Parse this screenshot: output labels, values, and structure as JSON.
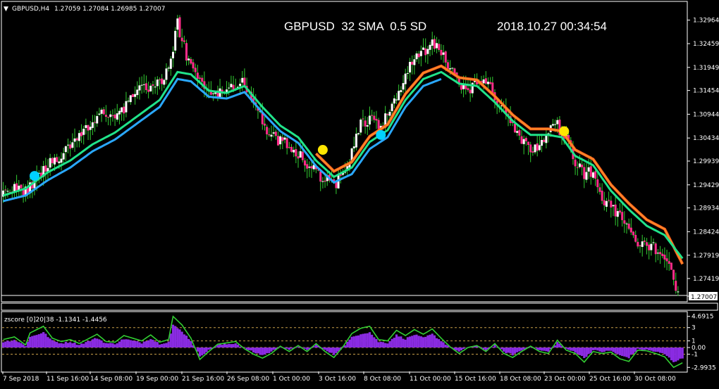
{
  "main_header": {
    "arrow": "▼",
    "symbol_tf": "GBPUSD,H4",
    "ohlc": "1.27059 1.27084 1.26985 1.27007"
  },
  "overlay": {
    "title": "GBPUSD  32 SMA  0.5 SD",
    "datetime": "2018.10.27 00:34:54"
  },
  "current_price_label": "1.27007",
  "price_axis": {
    "labels": [
      "1.32964",
      "1.32459",
      "1.31949",
      "1.31454",
      "1.30944",
      "1.30434",
      "1.29939",
      "1.29429",
      "1.28934",
      "1.28424",
      "1.27919",
      "1.27419"
    ],
    "values": [
      1.32964,
      1.32459,
      1.31949,
      1.31454,
      1.30944,
      1.30434,
      1.29939,
      1.29429,
      1.28934,
      1.28424,
      1.27919,
      1.27419
    ],
    "range": [
      1.2695,
      1.3335
    ]
  },
  "sub_header": "zscore [0]20|38 -1.1341 -1.4456",
  "z_axis": {
    "labels": [
      "4.6915",
      "3",
      "1",
      "0.00",
      "-1",
      "-2.9935"
    ],
    "values": [
      4.6915,
      3,
      1,
      0,
      -1,
      -2.9935
    ],
    "range": [
      -3.6,
      5.3
    ]
  },
  "time_axis": [
    "7 Sep 2018",
    "11 Sep 16:00",
    "14 Sep 08:00",
    "19 Sep 00:00",
    "21 Sep 16:00",
    "26 Sep 08:00",
    "1 Oct 00:00",
    "3 Oct 16:00",
    "8 Oct 08:00",
    "11 Oct 00:00",
    "15 Oct 16:00",
    "18 Oct 08:00",
    "23 Oct 00:00",
    "25 Oct 16:00",
    "30 Oct 08:00"
  ],
  "colors": {
    "up_candle": "#ffffff",
    "down_candle": "#ff2d8a",
    "wick": "#32cd32",
    "sma_center": "#20e38a",
    "band_lower": "#2aa8ff",
    "band_upper": "#ff8c2a",
    "signal_buy": "#00d2ff",
    "signal_sell": "#ffe600",
    "zscore_line": "#32cd32",
    "zscore_hist": "#8a2be2",
    "axis": "#ffffff",
    "level_line": "#c8a04a"
  },
  "chart_data": [
    {
      "type": "candlestick",
      "title": "GBPUSD  32 SMA  0.5 SD",
      "ylim": [
        1.2695,
        1.3335
      ],
      "close_path": [
        [
          0,
          1.292
        ],
        [
          5,
          1.2935
        ],
        [
          10,
          1.293
        ],
        [
          15,
          1.296
        ],
        [
          20,
          1.2985
        ],
        [
          25,
          1.3
        ],
        [
          30,
          1.303
        ],
        [
          35,
          1.3055
        ],
        [
          40,
          1.308
        ],
        [
          45,
          1.31
        ],
        [
          50,
          1.3095
        ],
        [
          55,
          1.311
        ],
        [
          60,
          1.3145
        ],
        [
          65,
          1.315
        ],
        [
          70,
          1.316
        ],
        [
          75,
          1.321
        ],
        [
          78,
          1.329
        ],
        [
          82,
          1.322
        ],
        [
          86,
          1.319
        ],
        [
          90,
          1.314
        ],
        [
          95,
          1.3135
        ],
        [
          100,
          1.3145
        ],
        [
          104,
          1.316
        ],
        [
          108,
          1.3165
        ],
        [
          112,
          1.312
        ],
        [
          116,
          1.308
        ],
        [
          120,
          1.3045
        ],
        [
          124,
          1.3035
        ],
        [
          128,
          1.303
        ],
        [
          132,
          1.301
        ],
        [
          136,
          1.2985
        ],
        [
          140,
          1.297
        ],
        [
          144,
          1.2955
        ],
        [
          148,
          1.2945
        ],
        [
          152,
          1.296
        ],
        [
          156,
          1.301
        ],
        [
          160,
          1.307
        ],
        [
          164,
          1.3085
        ],
        [
          168,
          1.3065
        ],
        [
          172,
          1.3095
        ],
        [
          176,
          1.313
        ],
        [
          180,
          1.3185
        ],
        [
          184,
          1.3215
        ],
        [
          188,
          1.323
        ],
        [
          192,
          1.3245
        ],
        [
          196,
          1.3225
        ],
        [
          200,
          1.3195
        ],
        [
          204,
          1.315
        ],
        [
          208,
          1.314
        ],
        [
          212,
          1.3165
        ],
        [
          216,
          1.3165
        ],
        [
          220,
          1.313
        ],
        [
          224,
          1.31
        ],
        [
          228,
          1.3065
        ],
        [
          232,
          1.3035
        ],
        [
          236,
          1.302
        ],
        [
          240,
          1.303
        ],
        [
          244,
          1.3065
        ],
        [
          248,
          1.307
        ],
        [
          252,
          1.304
        ],
        [
          256,
          1.2995
        ],
        [
          260,
          1.2965
        ],
        [
          264,
          1.2975
        ],
        [
          268,
          1.2915
        ],
        [
          272,
          1.289
        ],
        [
          276,
          1.288
        ],
        [
          280,
          1.2845
        ],
        [
          284,
          1.281
        ],
        [
          288,
          1.2815
        ],
        [
          292,
          1.2805
        ],
        [
          296,
          1.2795
        ],
        [
          300,
          1.274
        ],
        [
          302,
          1.2705
        ]
      ],
      "sma_center": [
        [
          0,
          1.292
        ],
        [
          10,
          1.2935
        ],
        [
          20,
          1.297
        ],
        [
          30,
          1.2995
        ],
        [
          40,
          1.303
        ],
        [
          50,
          1.3055
        ],
        [
          60,
          1.309
        ],
        [
          70,
          1.3125
        ],
        [
          78,
          1.3185
        ],
        [
          84,
          1.318
        ],
        [
          92,
          1.3145
        ],
        [
          100,
          1.314
        ],
        [
          108,
          1.3155
        ],
        [
          116,
          1.311
        ],
        [
          124,
          1.307
        ],
        [
          132,
          1.3045
        ],
        [
          140,
          1.2995
        ],
        [
          148,
          1.296
        ],
        [
          156,
          1.298
        ],
        [
          164,
          1.3035
        ],
        [
          172,
          1.306
        ],
        [
          180,
          1.3125
        ],
        [
          188,
          1.317
        ],
        [
          196,
          1.3185
        ],
        [
          204,
          1.316
        ],
        [
          212,
          1.3155
        ],
        [
          220,
          1.312
        ],
        [
          228,
          1.308
        ],
        [
          236,
          1.305
        ],
        [
          244,
          1.305
        ],
        [
          250,
          1.3045
        ],
        [
          256,
          1.3005
        ],
        [
          264,
          1.2985
        ],
        [
          272,
          1.293
        ],
        [
          280,
          1.289
        ],
        [
          288,
          1.2855
        ],
        [
          296,
          1.2835
        ],
        [
          304,
          1.2785
        ]
      ],
      "band_lower": [
        [
          0,
          1.2908
        ],
        [
          10,
          1.292
        ],
        [
          20,
          1.2953
        ],
        [
          30,
          1.298
        ],
        [
          40,
          1.3015
        ],
        [
          50,
          1.304
        ],
        [
          60,
          1.3075
        ],
        [
          70,
          1.311
        ],
        [
          78,
          1.317
        ],
        [
          84,
          1.3165
        ],
        [
          92,
          1.3132
        ],
        [
          100,
          1.3128
        ],
        [
          108,
          1.3142
        ],
        [
          116,
          1.3098
        ],
        [
          124,
          1.3058
        ],
        [
          132,
          1.3033
        ],
        [
          140,
          1.2983
        ],
        [
          148,
          1.2948
        ],
        [
          156,
          1.2966
        ],
        [
          164,
          1.302
        ],
        [
          172,
          1.3045
        ],
        [
          180,
          1.311
        ],
        [
          188,
          1.3155
        ],
        [
          196,
          1.317
        ]
      ],
      "band_upper": [
        [
          140,
          1.301
        ],
        [
          148,
          1.2972
        ],
        [
          156,
          1.2992
        ],
        [
          164,
          1.3047
        ],
        [
          172,
          1.3072
        ],
        [
          180,
          1.3138
        ],
        [
          188,
          1.3183
        ],
        [
          196,
          1.3198
        ],
        [
          204,
          1.3173
        ],
        [
          212,
          1.3168
        ],
        [
          220,
          1.3133
        ],
        [
          228,
          1.3093
        ],
        [
          236,
          1.3063
        ],
        [
          244,
          1.3063
        ],
        [
          250,
          1.3058
        ],
        [
          256,
          1.3018
        ],
        [
          264,
          1.2998
        ],
        [
          272,
          1.2943
        ],
        [
          280,
          1.2903
        ],
        [
          288,
          1.2868
        ],
        [
          296,
          1.2848
        ],
        [
          304,
          1.2773
        ]
      ],
      "signals": [
        {
          "type": "buy",
          "i": 14,
          "price": 1.2962
        },
        {
          "type": "sell",
          "i": 143,
          "price": 1.3018
        },
        {
          "type": "buy",
          "i": 169,
          "price": 1.305
        },
        {
          "type": "sell",
          "i": 251,
          "price": 1.3058
        }
      ]
    },
    {
      "type": "line",
      "title": "zscore [0]20|38 -1.1341 -1.4456",
      "ylim": [
        -3.6,
        5.3
      ],
      "levels": [
        3,
        1,
        0,
        -1
      ],
      "values": [
        [
          0,
          1.2
        ],
        [
          5,
          1.6
        ],
        [
          10,
          0.4
        ],
        [
          12,
          2.2
        ],
        [
          18,
          3.2
        ],
        [
          22,
          1.4
        ],
        [
          26,
          0.9
        ],
        [
          30,
          1.2
        ],
        [
          34,
          0.6
        ],
        [
          38,
          1.3
        ],
        [
          42,
          2.0
        ],
        [
          46,
          0.9
        ],
        [
          50,
          0.8
        ],
        [
          54,
          1.8
        ],
        [
          58,
          1.4
        ],
        [
          62,
          1.0
        ],
        [
          66,
          1.9
        ],
        [
          70,
          0.8
        ],
        [
          74,
          1.2
        ],
        [
          76,
          4.69
        ],
        [
          80,
          3.4
        ],
        [
          84,
          1.4
        ],
        [
          88,
          -1.8
        ],
        [
          92,
          -0.6
        ],
        [
          96,
          0.5
        ],
        [
          100,
          0.7
        ],
        [
          104,
          0.9
        ],
        [
          108,
          -0.2
        ],
        [
          112,
          -1.0
        ],
        [
          116,
          -1.6
        ],
        [
          120,
          -0.9
        ],
        [
          124,
          0.2
        ],
        [
          128,
          -0.6
        ],
        [
          132,
          0.3
        ],
        [
          136,
          -0.6
        ],
        [
          140,
          0.6
        ],
        [
          144,
          -0.6
        ],
        [
          148,
          -1.5
        ],
        [
          152,
          0.1
        ],
        [
          156,
          2.1
        ],
        [
          160,
          2.9
        ],
        [
          164,
          3.2
        ],
        [
          168,
          1.2
        ],
        [
          172,
          1.0
        ],
        [
          176,
          2.6
        ],
        [
          180,
          1.8
        ],
        [
          184,
          2.7
        ],
        [
          188,
          2.0
        ],
        [
          192,
          2.8
        ],
        [
          196,
          1.4
        ],
        [
          200,
          0.1
        ],
        [
          204,
          -0.9
        ],
        [
          208,
          0.0
        ],
        [
          212,
          0.3
        ],
        [
          216,
          -0.6
        ],
        [
          220,
          0.6
        ],
        [
          224,
          -0.9
        ],
        [
          228,
          -1.5
        ],
        [
          232,
          -0.6
        ],
        [
          236,
          0.2
        ],
        [
          240,
          -0.6
        ],
        [
          244,
          -0.9
        ],
        [
          248,
          1.1
        ],
        [
          252,
          -0.4
        ],
        [
          256,
          -0.9
        ],
        [
          260,
          -2.2
        ],
        [
          264,
          -0.6
        ],
        [
          268,
          -0.9
        ],
        [
          272,
          -0.7
        ],
        [
          276,
          -1.7
        ],
        [
          280,
          -2.1
        ],
        [
          284,
          -0.4
        ],
        [
          288,
          -0.5
        ],
        [
          292,
          -0.9
        ],
        [
          296,
          -1.4
        ],
        [
          300,
          -2.99
        ],
        [
          304,
          -2.3
        ]
      ]
    }
  ]
}
